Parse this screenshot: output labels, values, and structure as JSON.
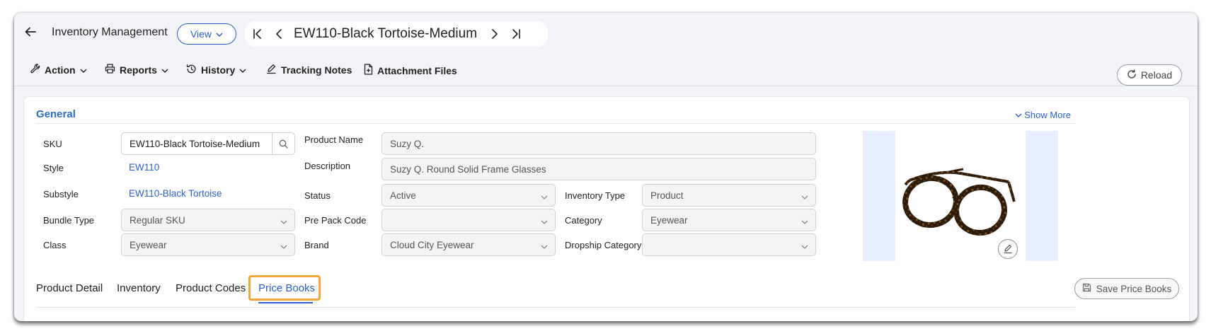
{
  "header": {
    "title": "Inventory Management",
    "view_label": "View",
    "record_title": "EW110-Black Tortoise-Medium"
  },
  "toolbar": {
    "action": "Action",
    "reports": "Reports",
    "history": "History",
    "tracking_notes": "Tracking Notes",
    "attachment_files": "Attachment Files",
    "reload": "Reload"
  },
  "general": {
    "section_title": "General",
    "show_more": "Show More",
    "labels": {
      "sku": "SKU",
      "style": "Style",
      "substyle": "Substyle",
      "bundle_type": "Bundle Type",
      "class": "Class",
      "product_name": "Product Name",
      "description": "Description",
      "status": "Status",
      "pre_pack_code": "Pre Pack Code",
      "brand": "Brand",
      "inventory_type": "Inventory Type",
      "category": "Category",
      "dropship_category": "Dropship Category"
    },
    "values": {
      "sku": "EW110-Black Tortoise-Medium",
      "style": "EW110",
      "substyle": "EW110-Black Tortoise",
      "bundle_type": "Regular SKU",
      "class": "Eyewear",
      "product_name": "Suzy Q.",
      "description": "Suzy Q. Round Solid Frame Glasses",
      "status": "Active",
      "pre_pack_code": "",
      "brand": "Cloud City Eyewear",
      "inventory_type": "Product",
      "category": "Eyewear",
      "dropship_category": ""
    }
  },
  "tabs": [
    {
      "label": "Product Detail"
    },
    {
      "label": "Inventory"
    },
    {
      "label": "Product Codes"
    },
    {
      "label": "Price Books",
      "active": true
    }
  ],
  "save_price_books": "Save Price Books",
  "colors": {
    "accent": "#2f5fd0",
    "highlight": "#f0a83a",
    "section_title": "#2f6cc4"
  }
}
